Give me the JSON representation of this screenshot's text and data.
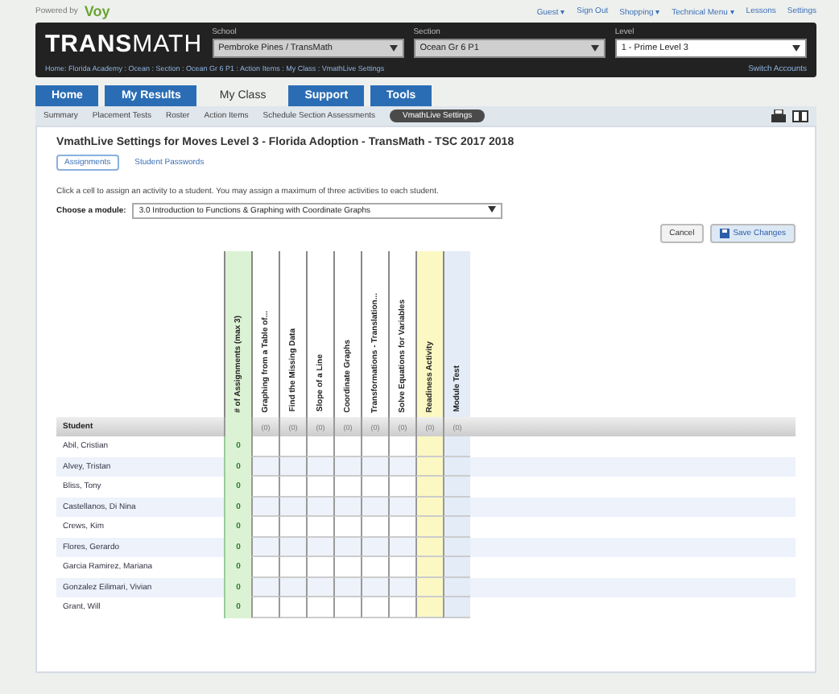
{
  "top_bar": {
    "brand": "Powered by",
    "brand_mark": "Voy",
    "links": [
      "Guest ▾",
      "Sign Out",
      "Shopping ▾",
      "Technical Menu ▾",
      "Lessons",
      "Settings"
    ]
  },
  "header": {
    "logo_bold": "TRANS",
    "logo_light": "MATH",
    "selectors": [
      {
        "label": "School",
        "value": "Pembroke Pines / TransMath",
        "light": false
      },
      {
        "label": "Section",
        "value": "Ocean Gr 6 P1",
        "light": false
      },
      {
        "label": "Level",
        "value": "1 - Prime Level 3",
        "light": true
      }
    ],
    "breadcrumb": "Home: Florida Academy : Ocean : Section : Ocean Gr 6 P1 : Action Items : My Class : VmathLive Settings",
    "account_link": "Switch Accounts"
  },
  "main_tabs": [
    {
      "label": "Home",
      "selected": false
    },
    {
      "label": "My Results",
      "selected": false
    },
    {
      "label": "My Class",
      "selected": true
    },
    {
      "label": "Support",
      "selected": false
    },
    {
      "label": "Tools",
      "selected": false
    }
  ],
  "sub_tabs": [
    {
      "label": "Summary",
      "selected": false
    },
    {
      "label": "Placement Tests",
      "selected": false
    },
    {
      "label": "Roster",
      "selected": false
    },
    {
      "label": "Action Items",
      "selected": false
    },
    {
      "label": "Schedule Section Assessments",
      "selected": false
    },
    {
      "label": "VmathLive Settings",
      "selected": true
    }
  ],
  "page_title": "VmathLive Settings for Moves Level 3 - Florida Adoption - TransMath - TSC 2017 2018",
  "view_tabs": [
    {
      "label": "Assignments",
      "selected": true
    },
    {
      "label": "Student Passwords",
      "selected": false
    }
  ],
  "instructions": "Click a cell to assign an activity to a student. You may assign a maximum of three activities to each student.",
  "module": {
    "label": "Choose a module:",
    "value": "3.0 Introduction to Functions & Graphing with Coordinate Graphs"
  },
  "buttons": [
    {
      "label": "Cancel",
      "kind": "plain"
    },
    {
      "label": "Save Changes",
      "kind": "save"
    }
  ],
  "table": {
    "student_header": "Student",
    "count_column": "# of Assignments (max 3)",
    "columns": [
      {
        "label": "Graphing from a Table of...",
        "count": "(0)",
        "color": "#ffffff"
      },
      {
        "label": "Find the Missing Data",
        "count": "(0)",
        "color": "#ffffff"
      },
      {
        "label": "Slope of a Line",
        "count": "(0)",
        "color": "#ffffff"
      },
      {
        "label": "Coordinate Graphs",
        "count": "(0)",
        "color": "#ffffff"
      },
      {
        "label": "Transformations - Translation...",
        "count": "(0)",
        "color": "#ffffff"
      },
      {
        "label": "Solve Equations for Variables",
        "count": "(0)",
        "color": "#ffffff"
      },
      {
        "label": "Readiness Activity",
        "count": "(0)",
        "color": "#fbf8c4"
      },
      {
        "label": "Module Test",
        "count": "(0)",
        "color": "#e4ecf8"
      }
    ],
    "rows": [
      {
        "student": "Abil, Cristian",
        "count": "0"
      },
      {
        "student": "Alvey, Tristan",
        "count": "0"
      },
      {
        "student": "Bliss, Tony",
        "count": "0"
      },
      {
        "student": "Castellanos, Di Nina",
        "count": "0"
      },
      {
        "student": "Crews, Kim",
        "count": "0"
      },
      {
        "student": "Flores, Gerardo",
        "count": "0"
      },
      {
        "student": "Garcia Ramirez, Mariana",
        "count": "0"
      },
      {
        "student": "Gonzalez Eilimari, Vivian",
        "count": "0"
      },
      {
        "student": "Grant, Will",
        "count": "0"
      }
    ]
  }
}
